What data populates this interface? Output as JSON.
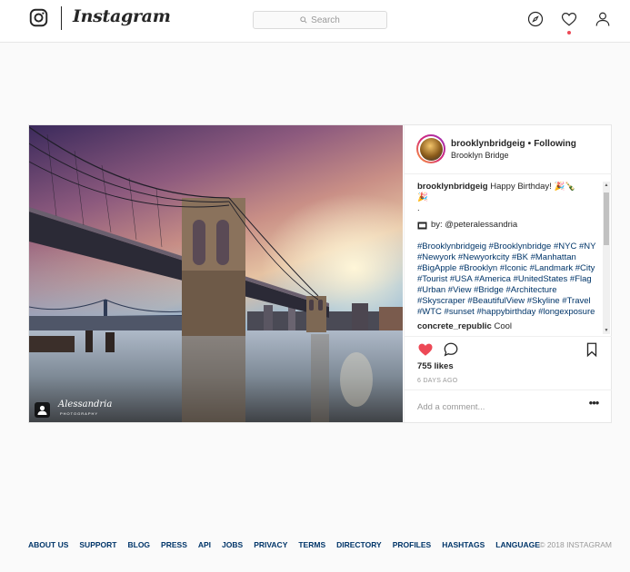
{
  "header": {
    "brand": "Instagram",
    "search_placeholder": "Search"
  },
  "post": {
    "username": "brooklynbridgeig",
    "follow_separator": "•",
    "follow_status": "Following",
    "location": "Brooklyn Bridge",
    "caption_user": "brooklynbridgeig",
    "caption_text": "Happy Birthday! 🎉🍾",
    "caption_emoji_2": "🎉",
    "caption_dot": ".",
    "by_label": "by: @peteralessandria",
    "hashtags": "#Brooklynbridgeig #Brooklynbridge #NYC #NY #Newyork #Newyorkcity #BK #Manhattan #BigApple #Brooklyn #Iconic #Landmark #City #Tourist #USA #America #UnitedStates #Flag #Urban #View #Bridge #Architecture #Skyscraper #BeautifulView #Skyline #Travel #WTC #sunset #happybirthday #longexposure",
    "second_comment_user": "concrete_republic",
    "second_comment_text": "Cool",
    "likes": "755 likes",
    "posted_time": "6 DAYS AGO",
    "comment_placeholder": "Add a comment...",
    "more_label": "•••",
    "watermark": "Alessandria",
    "watermark_sub": "PHOTOGRAPHY"
  },
  "footer": {
    "links": [
      "ABOUT US",
      "SUPPORT",
      "BLOG",
      "PRESS",
      "API",
      "JOBS",
      "PRIVACY",
      "TERMS",
      "DIRECTORY",
      "PROFILES",
      "HASHTAGS",
      "LANGUAGE"
    ],
    "copyright": "© 2018 INSTAGRAM"
  },
  "colors": {
    "like_red": "#ed4956",
    "link_blue": "#003569",
    "border": "#e6e6e6"
  },
  "icons": [
    "instagram-glyph-icon",
    "search-icon",
    "compass-icon",
    "heart-icon",
    "user-icon",
    "tag-people-icon",
    "like-heart-icon",
    "comment-bubble-icon",
    "bookmark-icon",
    "film-icon"
  ]
}
